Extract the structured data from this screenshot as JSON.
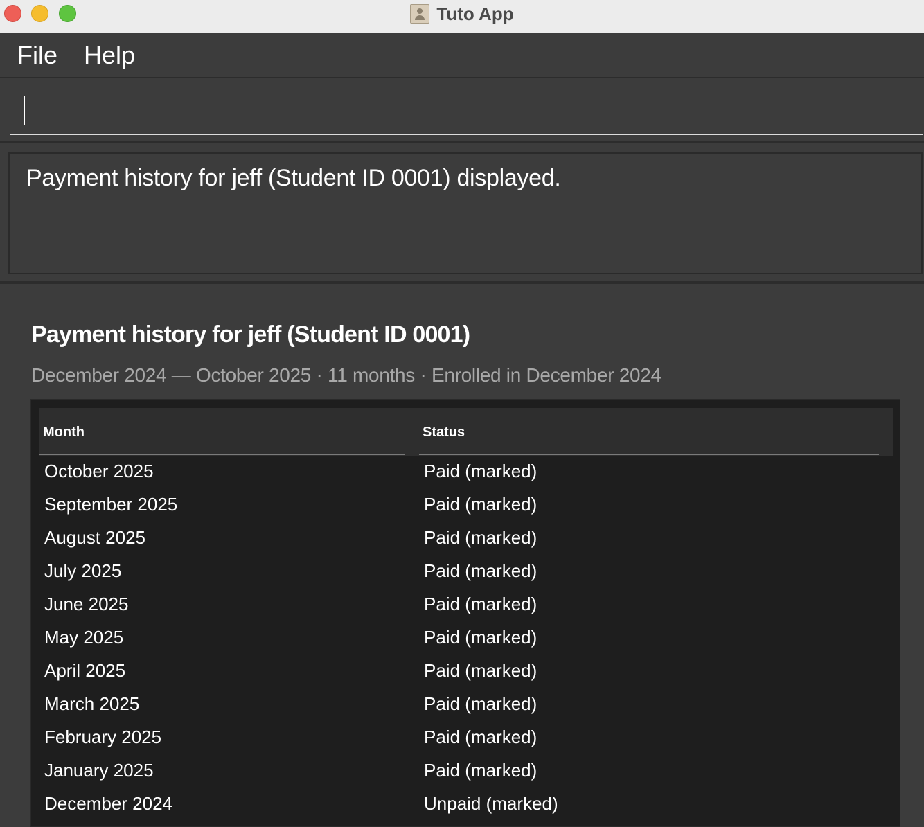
{
  "window": {
    "title": "Tuto App"
  },
  "menu": {
    "items": [
      "File",
      "Help"
    ]
  },
  "command": {
    "value": "",
    "placeholder": ""
  },
  "result": {
    "message": "Payment history for jeff (Student ID 0001) displayed."
  },
  "panel": {
    "title": "Payment history for jeff (Student ID 0001)",
    "subtitle": "December 2024 — October 2025 · 11 months · Enrolled in December 2024"
  },
  "table": {
    "headers": {
      "month": "Month",
      "status": "Status"
    },
    "rows": [
      {
        "month": "October 2025",
        "status": "Paid (marked)"
      },
      {
        "month": "September 2025",
        "status": "Paid (marked)"
      },
      {
        "month": "August 2025",
        "status": "Paid (marked)"
      },
      {
        "month": "July 2025",
        "status": "Paid (marked)"
      },
      {
        "month": "June 2025",
        "status": "Paid (marked)"
      },
      {
        "month": "May 2025",
        "status": "Paid (marked)"
      },
      {
        "month": "April 2025",
        "status": "Paid (marked)"
      },
      {
        "month": "March 2025",
        "status": "Paid (marked)"
      },
      {
        "month": "February 2025",
        "status": "Paid (marked)"
      },
      {
        "month": "January 2025",
        "status": "Paid (marked)"
      },
      {
        "month": "December 2024",
        "status": "Unpaid (marked)"
      }
    ]
  },
  "icons": {
    "close": "close-icon",
    "minimize": "minimize-icon",
    "maximize": "maximize-icon",
    "app": "contact-book-icon"
  },
  "colors": {
    "background": "#3c3c3c",
    "table_background": "#1e1e1e",
    "text": "#ffffff",
    "subtitle": "#a8a8a8"
  }
}
